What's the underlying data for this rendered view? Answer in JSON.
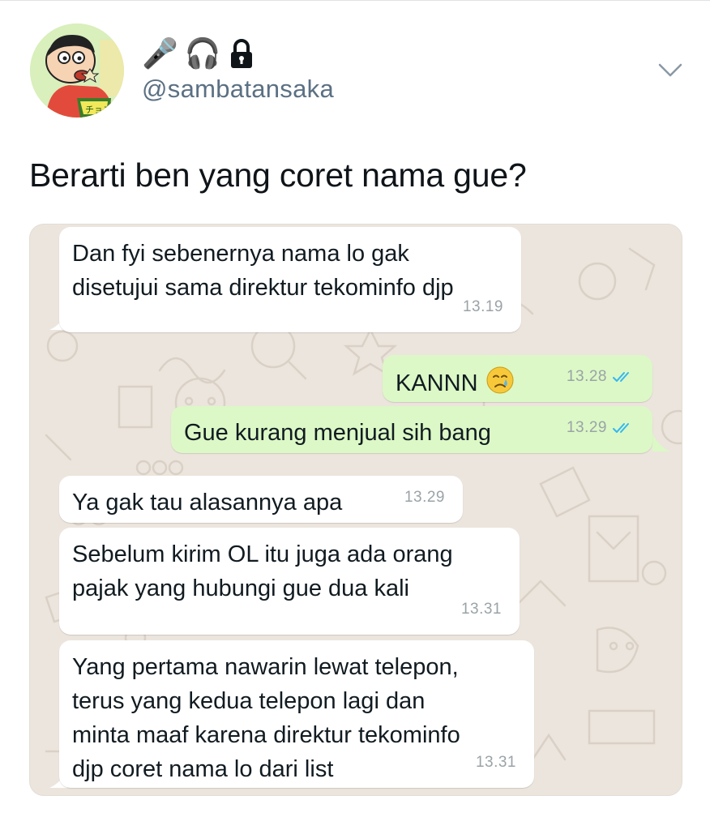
{
  "tweet": {
    "display_name_icons": [
      "microphone-icon",
      "headphones-icon",
      "lock-icon"
    ],
    "display_name_emoji": [
      "🎤",
      "🎧"
    ],
    "handle": "@sambatansaka",
    "text": "Berarti ben yang coret nama gue?"
  },
  "chat": {
    "messages": [
      {
        "side": "in",
        "text": "Dan fyi sebenernya nama lo gak\ndisetujui sama direktur tekominfo djp",
        "time": "13.19"
      },
      {
        "side": "out",
        "text": "KANNN",
        "emoji": "crying-face-icon",
        "time": "13.28",
        "read": true
      },
      {
        "side": "out",
        "text": "Gue kurang menjual sih bang",
        "time": "13.29",
        "read": true
      },
      {
        "side": "in",
        "text": "Ya gak tau alasannya apa",
        "time": "13.29"
      },
      {
        "side": "in",
        "text": "Sebelum kirim OL itu juga ada orang\npajak yang hubungi gue dua kali",
        "time": "13.31"
      },
      {
        "side": "in",
        "text": "Yang pertama nawarin lewat telepon,\nterus yang kedua telepon lagi dan\nminta maaf karena direktur tekominfo\ndjp coret nama lo dari list",
        "time": "13.31"
      }
    ]
  },
  "colors": {
    "incoming_bubble": "#ffffff",
    "outgoing_bubble": "#dcf8c6",
    "chat_background": "#ece5dd",
    "read_ticks": "#34b7f1",
    "handle": "#5b7083"
  }
}
